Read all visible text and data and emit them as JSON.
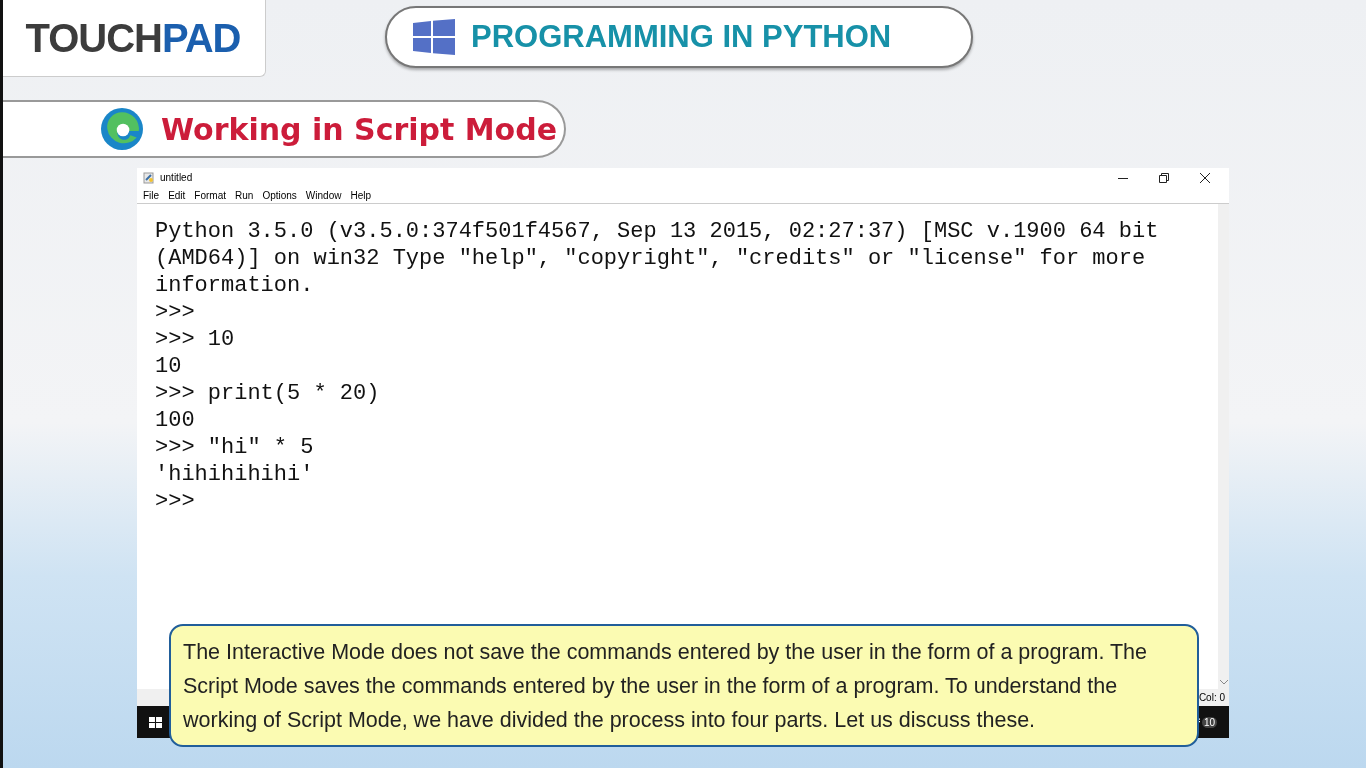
{
  "logo": {
    "dark": "TOUCH",
    "accent": "PAD"
  },
  "banner": {
    "title": "PROGRAMMING IN PYTHON"
  },
  "section": {
    "title": "Working in Script Mode"
  },
  "window": {
    "title": "untitled",
    "menu": [
      "File",
      "Edit",
      "Format",
      "Run",
      "Options",
      "Window",
      "Help"
    ],
    "lines": [
      "Python 3.5.0 (v3.5.0:374f501f4567, Sep 13 2015, 02:27:37) [MSC v.1900 64 bit",
      "(AMD64)] on win32 Type \"help\", \"copyright\", \"credits\" or \"license\" for more",
      "information.",
      ">>>",
      ">>> 10",
      "10",
      ">>> print(5 * 20)",
      "100",
      ">>> \"hi\" * 5",
      "'hihihihihi'",
      ">>>"
    ],
    "status": "Col: 0"
  },
  "taskbar": {
    "notification_count": "10"
  },
  "caption": "The Interactive Mode does not save the commands entered by the user in the form of a program. The Script Mode saves the commands entered by the user in the form of a program. To understand the working of Script Mode, we have divided the process into four parts. Let us discuss these."
}
